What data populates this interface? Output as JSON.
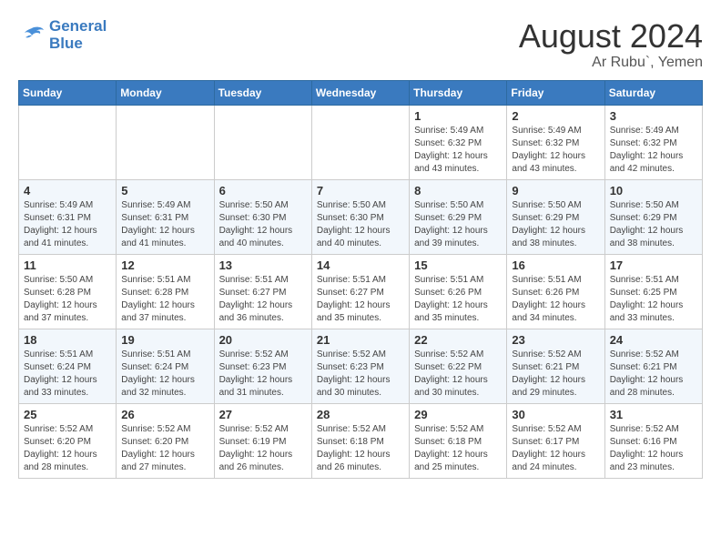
{
  "header": {
    "logo_line1": "General",
    "logo_line2": "Blue",
    "month_year": "August 2024",
    "location": "Ar Rubu`, Yemen"
  },
  "weekdays": [
    "Sunday",
    "Monday",
    "Tuesday",
    "Wednesday",
    "Thursday",
    "Friday",
    "Saturday"
  ],
  "weeks": [
    [
      {
        "day": "",
        "info": ""
      },
      {
        "day": "",
        "info": ""
      },
      {
        "day": "",
        "info": ""
      },
      {
        "day": "",
        "info": ""
      },
      {
        "day": "1",
        "info": "Sunrise: 5:49 AM\nSunset: 6:32 PM\nDaylight: 12 hours\nand 43 minutes."
      },
      {
        "day": "2",
        "info": "Sunrise: 5:49 AM\nSunset: 6:32 PM\nDaylight: 12 hours\nand 43 minutes."
      },
      {
        "day": "3",
        "info": "Sunrise: 5:49 AM\nSunset: 6:32 PM\nDaylight: 12 hours\nand 42 minutes."
      }
    ],
    [
      {
        "day": "4",
        "info": "Sunrise: 5:49 AM\nSunset: 6:31 PM\nDaylight: 12 hours\nand 41 minutes."
      },
      {
        "day": "5",
        "info": "Sunrise: 5:49 AM\nSunset: 6:31 PM\nDaylight: 12 hours\nand 41 minutes."
      },
      {
        "day": "6",
        "info": "Sunrise: 5:50 AM\nSunset: 6:30 PM\nDaylight: 12 hours\nand 40 minutes."
      },
      {
        "day": "7",
        "info": "Sunrise: 5:50 AM\nSunset: 6:30 PM\nDaylight: 12 hours\nand 40 minutes."
      },
      {
        "day": "8",
        "info": "Sunrise: 5:50 AM\nSunset: 6:29 PM\nDaylight: 12 hours\nand 39 minutes."
      },
      {
        "day": "9",
        "info": "Sunrise: 5:50 AM\nSunset: 6:29 PM\nDaylight: 12 hours\nand 38 minutes."
      },
      {
        "day": "10",
        "info": "Sunrise: 5:50 AM\nSunset: 6:29 PM\nDaylight: 12 hours\nand 38 minutes."
      }
    ],
    [
      {
        "day": "11",
        "info": "Sunrise: 5:50 AM\nSunset: 6:28 PM\nDaylight: 12 hours\nand 37 minutes."
      },
      {
        "day": "12",
        "info": "Sunrise: 5:51 AM\nSunset: 6:28 PM\nDaylight: 12 hours\nand 37 minutes."
      },
      {
        "day": "13",
        "info": "Sunrise: 5:51 AM\nSunset: 6:27 PM\nDaylight: 12 hours\nand 36 minutes."
      },
      {
        "day": "14",
        "info": "Sunrise: 5:51 AM\nSunset: 6:27 PM\nDaylight: 12 hours\nand 35 minutes."
      },
      {
        "day": "15",
        "info": "Sunrise: 5:51 AM\nSunset: 6:26 PM\nDaylight: 12 hours\nand 35 minutes."
      },
      {
        "day": "16",
        "info": "Sunrise: 5:51 AM\nSunset: 6:26 PM\nDaylight: 12 hours\nand 34 minutes."
      },
      {
        "day": "17",
        "info": "Sunrise: 5:51 AM\nSunset: 6:25 PM\nDaylight: 12 hours\nand 33 minutes."
      }
    ],
    [
      {
        "day": "18",
        "info": "Sunrise: 5:51 AM\nSunset: 6:24 PM\nDaylight: 12 hours\nand 33 minutes."
      },
      {
        "day": "19",
        "info": "Sunrise: 5:51 AM\nSunset: 6:24 PM\nDaylight: 12 hours\nand 32 minutes."
      },
      {
        "day": "20",
        "info": "Sunrise: 5:52 AM\nSunset: 6:23 PM\nDaylight: 12 hours\nand 31 minutes."
      },
      {
        "day": "21",
        "info": "Sunrise: 5:52 AM\nSunset: 6:23 PM\nDaylight: 12 hours\nand 30 minutes."
      },
      {
        "day": "22",
        "info": "Sunrise: 5:52 AM\nSunset: 6:22 PM\nDaylight: 12 hours\nand 30 minutes."
      },
      {
        "day": "23",
        "info": "Sunrise: 5:52 AM\nSunset: 6:21 PM\nDaylight: 12 hours\nand 29 minutes."
      },
      {
        "day": "24",
        "info": "Sunrise: 5:52 AM\nSunset: 6:21 PM\nDaylight: 12 hours\nand 28 minutes."
      }
    ],
    [
      {
        "day": "25",
        "info": "Sunrise: 5:52 AM\nSunset: 6:20 PM\nDaylight: 12 hours\nand 28 minutes."
      },
      {
        "day": "26",
        "info": "Sunrise: 5:52 AM\nSunset: 6:20 PM\nDaylight: 12 hours\nand 27 minutes."
      },
      {
        "day": "27",
        "info": "Sunrise: 5:52 AM\nSunset: 6:19 PM\nDaylight: 12 hours\nand 26 minutes."
      },
      {
        "day": "28",
        "info": "Sunrise: 5:52 AM\nSunset: 6:18 PM\nDaylight: 12 hours\nand 26 minutes."
      },
      {
        "day": "29",
        "info": "Sunrise: 5:52 AM\nSunset: 6:18 PM\nDaylight: 12 hours\nand 25 minutes."
      },
      {
        "day": "30",
        "info": "Sunrise: 5:52 AM\nSunset: 6:17 PM\nDaylight: 12 hours\nand 24 minutes."
      },
      {
        "day": "31",
        "info": "Sunrise: 5:52 AM\nSunset: 6:16 PM\nDaylight: 12 hours\nand 23 minutes."
      }
    ]
  ]
}
